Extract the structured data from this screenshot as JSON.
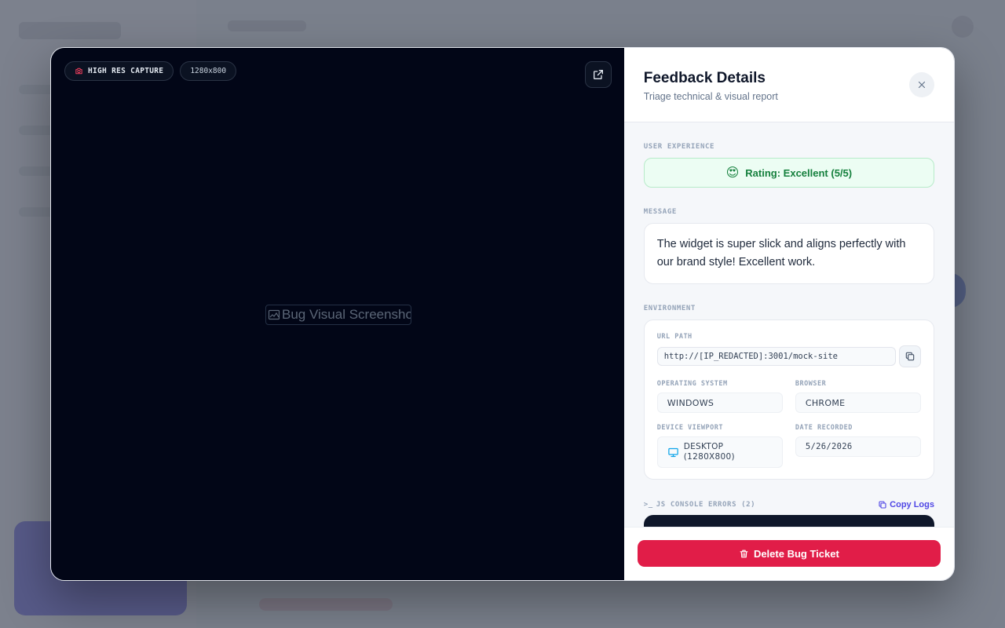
{
  "preview": {
    "badge_capture": "HIGH RES CAPTURE",
    "badge_resolution": "1280x800",
    "image_alt": "Bug Visual Screenshot"
  },
  "panel": {
    "title": "Feedback Details",
    "subtitle": "Triage technical & visual report"
  },
  "experience": {
    "label": "USER EXPERIENCE",
    "rating_text": "Rating: Excellent (5/5)",
    "rating_emoji": "😍"
  },
  "message": {
    "label": "MESSAGE",
    "text": "The widget is super slick and aligns perfectly with our brand style! Excellent work."
  },
  "environment": {
    "label": "ENVIRONMENT",
    "url_label": "URL PATH",
    "url_value": "http://[IP_REDACTED]:3001/mock-site",
    "os_label": "OPERATING SYSTEM",
    "os_value": "WINDOWS",
    "browser_label": "BROWSER",
    "browser_value": "CHROME",
    "viewport_label": "DEVICE VIEWPORT",
    "viewport_value": "DESKTOP (1280X800)",
    "date_label": "DATE RECORDED",
    "date_value": "5/26/2026"
  },
  "console": {
    "prompt": ">_",
    "label": "JS CONSOLE ERRORS (2)",
    "copy_label": "Copy Logs"
  },
  "footer": {
    "delete_label": "Delete Bug Ticket"
  },
  "colors": {
    "accent": "#4f46e5",
    "danger": "#e11d48",
    "success": "#15803d",
    "preview_bg": "#020617"
  }
}
